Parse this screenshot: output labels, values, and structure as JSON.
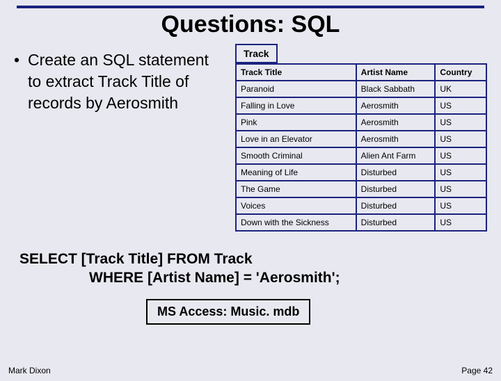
{
  "title": "Questions: SQL",
  "bullet_text": "Create an SQL statement to extract Track Title of records by Aerosmith",
  "table_label": "Track",
  "table": {
    "headers": [
      "Track Title",
      "Artist Name",
      "Country"
    ],
    "rows": [
      [
        "Paranoid",
        "Black Sabbath",
        "UK"
      ],
      [
        "Falling in Love",
        "Aerosmith",
        "US"
      ],
      [
        "Pink",
        "Aerosmith",
        "US"
      ],
      [
        "Love in an Elevator",
        "Aerosmith",
        "US"
      ],
      [
        "Smooth Criminal",
        "Alien Ant Farm",
        "US"
      ],
      [
        "Meaning of Life",
        "Disturbed",
        "US"
      ],
      [
        "The Game",
        "Disturbed",
        "US"
      ],
      [
        "Voices",
        "Disturbed",
        "US"
      ],
      [
        "Down with the Sickness",
        "Disturbed",
        "US"
      ]
    ]
  },
  "sql_line1": "SELECT [Track Title] FROM Track",
  "sql_line2": "WHERE [Artist Name] = 'Aerosmith';",
  "db_box": "MS Access: Music. mdb",
  "footer_left": "Mark Dixon",
  "footer_right": "Page 42"
}
